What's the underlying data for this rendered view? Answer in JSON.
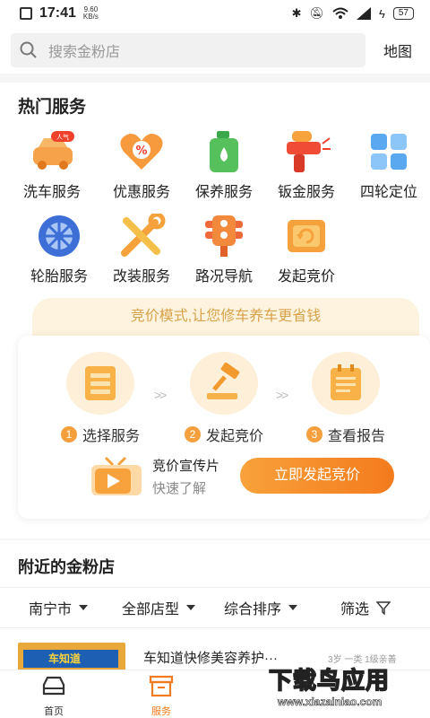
{
  "status_bar": {
    "time": "17:41",
    "net_speed_value": "9.60",
    "net_speed_unit": "KB/s",
    "battery": "57"
  },
  "search": {
    "placeholder": "搜索金粉店",
    "map_label": "地图"
  },
  "hot_services": {
    "title": "热门服务",
    "items": [
      {
        "label": "洗车服务",
        "icon": "car-wash-icon",
        "badge": "人气"
      },
      {
        "label": "优惠服务",
        "icon": "discount-heart-icon"
      },
      {
        "label": "保养服务",
        "icon": "oil-can-icon"
      },
      {
        "label": "钣金服务",
        "icon": "spray-gun-icon"
      },
      {
        "label": "四轮定位",
        "icon": "grid-squares-icon"
      },
      {
        "label": "轮胎服务",
        "icon": "tire-icon"
      },
      {
        "label": "改装服务",
        "icon": "wrench-tools-icon"
      },
      {
        "label": "路况导航",
        "icon": "traffic-light-icon"
      },
      {
        "label": "发起竞价",
        "icon": "bid-refresh-icon"
      }
    ]
  },
  "bidding": {
    "banner": "竞价模式,让您修车养车更省钱",
    "steps": [
      {
        "num": "1",
        "label": "选择服务"
      },
      {
        "num": "2",
        "label": "发起竞价"
      },
      {
        "num": "3",
        "label": "查看报告"
      }
    ],
    "promo_title": "竞价宣传片",
    "promo_sub": "快速了解",
    "cta": "立即发起竞价"
  },
  "nearby": {
    "title": "附近的金粉店",
    "filters": {
      "city": "南宁市",
      "shop_type": "全部店型",
      "sort": "综合排序",
      "filter": "筛选"
    },
    "shops": [
      {
        "name": "车知道快修美容养护···",
        "meta": "3岁 一类 1级亲善",
        "thumb_text": "车知道"
      }
    ]
  },
  "tabbar": {
    "home": "首页",
    "service": "服务"
  },
  "watermark": {
    "big": "下载鸟应用",
    "small": "www.xiazainiao.com"
  },
  "colors": {
    "accent": "#f37b1d",
    "banner_text": "#d8a24a"
  }
}
